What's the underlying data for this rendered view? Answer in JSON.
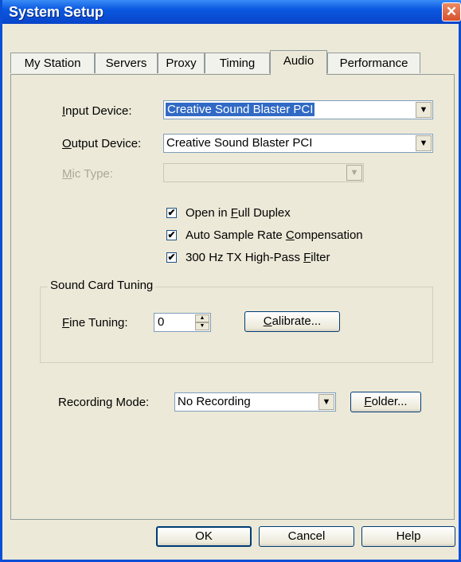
{
  "window": {
    "title": "System Setup",
    "close_glyph": "✕"
  },
  "tabs": [
    {
      "label": "My Station"
    },
    {
      "label": "Servers"
    },
    {
      "label": "Proxy"
    },
    {
      "label": "Timing"
    },
    {
      "label": "Audio",
      "active": true
    },
    {
      "label": "Performance"
    }
  ],
  "audio": {
    "input_device_label_mnemonic": "I",
    "input_device_label_rest": "nput Device:",
    "input_device_value": "Creative Sound Blaster PCI",
    "output_device_label_mnemonic": "O",
    "output_device_label_rest": "utput Device:",
    "output_device_value": "Creative Sound Blaster PCI",
    "mic_type_label_mnemonic": "M",
    "mic_type_label_rest": "ic Type:",
    "mic_type_value": "",
    "checkboxes": [
      {
        "pre": "Open in ",
        "mnemonic": "F",
        "post": "ull Duplex",
        "checked": true
      },
      {
        "pre": "Auto Sample Rate ",
        "mnemonic": "C",
        "post": "ompensation",
        "checked": true
      },
      {
        "pre": "300 Hz TX High-Pass ",
        "mnemonic": "F",
        "post": "ilter",
        "checked": true
      }
    ],
    "sound_card_tuning": {
      "title": "Sound Card Tuning",
      "fine_tuning_mnemonic": "F",
      "fine_tuning_rest": "ine Tuning:",
      "fine_tuning_value": "0",
      "calibrate_mnemonic": "C",
      "calibrate_rest": "alibrate..."
    },
    "recording_mode_label": "Recording Mode:",
    "recording_mode_value": "No Recording",
    "folder_mnemonic": "F",
    "folder_rest": "older..."
  },
  "buttons": {
    "ok": "OK",
    "cancel": "Cancel",
    "help": "Help"
  },
  "icons": {
    "dropdown": "▼",
    "check": "✔",
    "spin_up": "▲",
    "spin_down": "▼"
  },
  "colors": {
    "title_bar": "#0a58e0",
    "selection": "#316ac5",
    "face": "#ece9d8"
  }
}
